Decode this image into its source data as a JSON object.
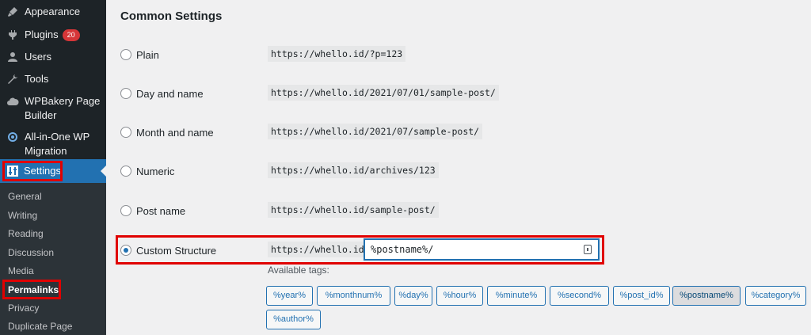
{
  "sidebar": {
    "items": [
      {
        "label": "Appearance",
        "icon": "paintbrush-icon"
      },
      {
        "label": "Plugins",
        "icon": "plugin-icon",
        "badge": "20"
      },
      {
        "label": "Users",
        "icon": "users-icon"
      },
      {
        "label": "Tools",
        "icon": "wrench-icon"
      },
      {
        "label": "WPBakery Page Builder",
        "icon": "cloud-icon"
      },
      {
        "label": "All-in-One WP Migration",
        "icon": "migration-icon"
      },
      {
        "label": "Settings",
        "icon": "settings-icon",
        "active": true
      }
    ],
    "submenu": [
      "General",
      "Writing",
      "Reading",
      "Discussion",
      "Media",
      "Permalinks",
      "Privacy",
      "Duplicate Page"
    ],
    "current_submenu": "Permalinks"
  },
  "main": {
    "section_title": "Common Settings",
    "options": [
      {
        "label": "Plain",
        "example": "https://whello.id/?p=123",
        "checked": false
      },
      {
        "label": "Day and name",
        "example": "https://whello.id/2021/07/01/sample-post/",
        "checked": false
      },
      {
        "label": "Month and name",
        "example": "https://whello.id/2021/07/sample-post/",
        "checked": false
      },
      {
        "label": "Numeric",
        "example": "https://whello.id/archives/123",
        "checked": false
      },
      {
        "label": "Post name",
        "example": "https://whello.id/sample-post/",
        "checked": false
      },
      {
        "label": "Custom Structure",
        "example": "https://whello.id",
        "checked": true
      }
    ],
    "custom_structure_value": "%postname%/",
    "available_tags_label": "Available tags:",
    "tags": [
      "%year%",
      "%monthnum%",
      "%day%",
      "%hour%",
      "%minute%",
      "%second%",
      "%post_id%",
      "%postname%",
      "%category%",
      "%author%"
    ],
    "active_tag": "%postname%"
  },
  "colors": {
    "sidebar_bg": "#1d2327",
    "submenu_bg": "#2c3338",
    "accent": "#2271b1",
    "highlight_border": "#e00000",
    "badge": "#d63638"
  }
}
